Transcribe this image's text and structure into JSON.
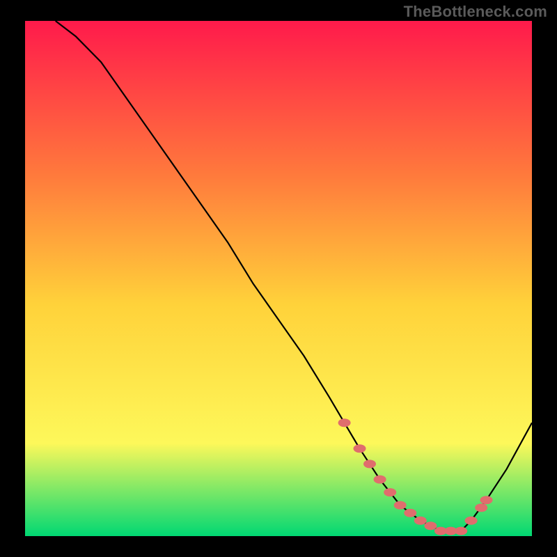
{
  "watermark": "TheBottleneck.com",
  "chart_data": {
    "type": "line",
    "title": "",
    "xlabel": "",
    "ylabel": "",
    "xlim": [
      0,
      100
    ],
    "ylim": [
      0,
      100
    ],
    "background_gradient": {
      "top": "#ff1a4b",
      "mid_upper": "#ff7a3c",
      "mid": "#ffd23a",
      "mid_lower": "#fdf85a",
      "bottom": "#00d873"
    },
    "series": [
      {
        "name": "bottleneck-curve",
        "color": "#000000",
        "x": [
          6,
          10,
          15,
          20,
          25,
          30,
          35,
          40,
          45,
          50,
          55,
          60,
          63,
          66,
          70,
          74,
          78,
          82,
          86,
          88,
          91,
          95,
          100
        ],
        "y": [
          100,
          97,
          92,
          85,
          78,
          71,
          64,
          57,
          49,
          42,
          35,
          27,
          22,
          17,
          11,
          6,
          3,
          1,
          1,
          3,
          7,
          13,
          22
        ]
      }
    ],
    "markers": {
      "name": "highlight-dots",
      "color": "#e06d6d",
      "points_x": [
        63,
        66,
        68,
        70,
        72,
        74,
        76,
        78,
        80,
        82,
        84,
        86,
        88,
        90,
        91
      ],
      "points_y": [
        22,
        17,
        14,
        11,
        8.5,
        6,
        4.5,
        3,
        2,
        1,
        1,
        1,
        3,
        5.5,
        7
      ]
    }
  }
}
